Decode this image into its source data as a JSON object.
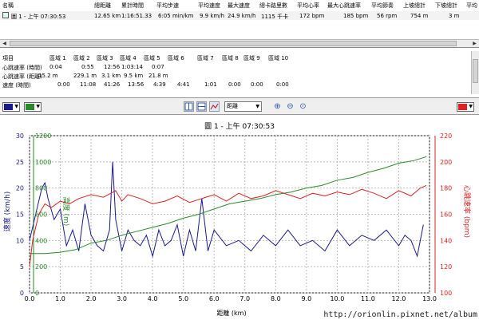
{
  "summary": {
    "headers": [
      "名稱",
      "總距離",
      "累計時間",
      "平均步速",
      "平均速度",
      "最大速度",
      "總卡路里數",
      "平均心率",
      "最大心跳速率",
      "平均節奏",
      "上坡總計",
      "下坡總計",
      "平均"
    ],
    "row": [
      "圖 1 - 上午 07:30:53",
      "12.65 km",
      "1:16:51.33",
      "6:05 min/km",
      "9.9 km/h",
      "24.9 km/h",
      "1115 千卡",
      "172 bpm",
      "185 bpm",
      "56 rpm",
      "754 m",
      "3 m"
    ]
  },
  "laps": {
    "headers": [
      "項目",
      "區域 1",
      "區域 2",
      "區域 3",
      "區域 4",
      "區域 5",
      "區域 6",
      "區域 7",
      "區域 8",
      "區域 9",
      "區域 10"
    ],
    "rows": [
      [
        "心跳速率 (時間)",
        "0:04",
        "0:55",
        "12:56",
        "1:03:14",
        "0:07",
        "",
        "",
        "",
        "",
        ""
      ],
      [
        "心跳速率 (距離)",
        "15.2 m",
        "229.1 m",
        "3.1 km",
        "9.5 km",
        "21.8 m",
        "",
        "",
        "",
        "",
        ""
      ],
      [
        "速度 (時間)",
        "0:00",
        "11:08",
        "41:26",
        "13:56",
        "4:39",
        "4:41",
        "1:01",
        "0:00",
        "0:00",
        "0:00"
      ]
    ]
  },
  "toolbar": {
    "left_color": "#1a1a8a",
    "right_color": "#2a8a2a",
    "end_color": "#dd2222",
    "axis_select": "距離"
  },
  "chart_data": {
    "type": "line",
    "title": "圖 1 - 上午 07:30:53",
    "xlabel": "距離 (km)",
    "xlim": [
      0,
      13
    ],
    "x_ticks": [
      "0.0",
      "1.0",
      "2.0",
      "3.0",
      "4.0",
      "5.0",
      "6.0",
      "7.0",
      "8.0",
      "9.0",
      "10.0",
      "11.0",
      "12.0",
      "13.0"
    ],
    "axes": [
      {
        "label": "速度 (km/h)",
        "ticks": [
          "0",
          "5",
          "10",
          "15",
          "20",
          "25",
          "30"
        ],
        "ylim": [
          0,
          30
        ],
        "color": "#1a1a8a"
      },
      {
        "label": "高度 (m)",
        "ticks": [
          "0",
          "200",
          "400",
          "600",
          "800",
          "1000",
          "1200"
        ],
        "ylim": [
          0,
          1200
        ],
        "color": "#2a8a2a"
      },
      {
        "label": "心跳速率 (bpm)",
        "ticks": [
          "100",
          "120",
          "140",
          "160",
          "180",
          "200",
          "220"
        ],
        "ylim": [
          100,
          220
        ],
        "color": "#dd2222"
      }
    ],
    "series": [
      {
        "name": "速度",
        "color": "#1a1a8a",
        "axis": 0,
        "x": [
          0,
          0.2,
          0.4,
          0.5,
          0.6,
          0.8,
          1.0,
          1.2,
          1.4,
          1.6,
          1.8,
          2.0,
          2.2,
          2.4,
          2.6,
          2.7,
          2.8,
          3.0,
          3.2,
          3.4,
          3.6,
          3.8,
          4.0,
          4.2,
          4.4,
          4.6,
          4.8,
          5.0,
          5.2,
          5.4,
          5.6,
          5.8,
          6.0,
          6.4,
          6.8,
          7.2,
          7.6,
          8.0,
          8.4,
          8.8,
          9.2,
          9.6,
          10.0,
          10.4,
          10.8,
          11.2,
          11.6,
          12.0,
          12.2,
          12.4,
          12.6,
          12.8
        ],
        "y": [
          10,
          15,
          20,
          21,
          18,
          14,
          16,
          9,
          12,
          8,
          17,
          11,
          9,
          8,
          12,
          25,
          14,
          8,
          12,
          10,
          9,
          11,
          7,
          12,
          9,
          10,
          13,
          7,
          12,
          8,
          18,
          8,
          12,
          9,
          10,
          8,
          11,
          9,
          12,
          9,
          10,
          8,
          12,
          9,
          11,
          10,
          12,
          9,
          11,
          10,
          7,
          13
        ]
      },
      {
        "name": "高度",
        "color": "#2a8a2a",
        "axis": 1,
        "x": [
          0,
          0.5,
          1.0,
          1.5,
          2.0,
          2.5,
          3.0,
          3.5,
          4.0,
          4.5,
          5.0,
          5.5,
          6.0,
          6.5,
          7.0,
          7.5,
          8.0,
          8.5,
          9.0,
          9.5,
          10.0,
          10.5,
          11.0,
          11.5,
          12.0,
          12.5,
          12.9
        ],
        "y": [
          300,
          300,
          310,
          330,
          380,
          400,
          440,
          470,
          500,
          530,
          570,
          600,
          640,
          680,
          700,
          720,
          750,
          770,
          800,
          820,
          860,
          880,
          920,
          950,
          990,
          1010,
          1040
        ]
      },
      {
        "name": "心跳速率",
        "color": "#dd2222",
        "axis": 2,
        "x": [
          0,
          0.1,
          0.2,
          0.3,
          0.5,
          0.7,
          1.0,
          1.3,
          1.6,
          2.0,
          2.4,
          2.8,
          3.0,
          3.2,
          3.6,
          4.0,
          4.4,
          4.8,
          5.2,
          5.6,
          6.0,
          6.4,
          6.8,
          7.2,
          7.6,
          8.0,
          8.4,
          8.8,
          9.2,
          9.6,
          10.0,
          10.4,
          10.8,
          11.2,
          11.6,
          12.0,
          12.4,
          12.7,
          12.9
        ],
        "y": [
          120,
          140,
          150,
          160,
          168,
          165,
          170,
          168,
          172,
          175,
          173,
          178,
          170,
          175,
          172,
          168,
          170,
          174,
          169,
          172,
          175,
          170,
          176,
          172,
          174,
          178,
          175,
          172,
          176,
          174,
          177,
          175,
          179,
          176,
          172,
          178,
          174,
          180,
          182
        ]
      }
    ]
  },
  "watermark": "http://orionlin.pixnet.net/album"
}
